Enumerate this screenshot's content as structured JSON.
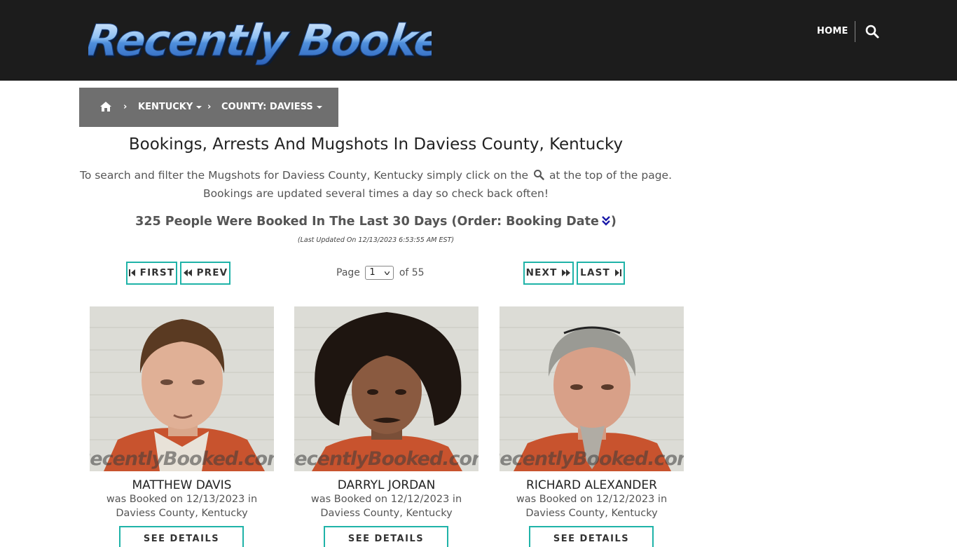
{
  "header": {
    "logo_text": "Recently Booked",
    "nav_home": "HOME",
    "search_icon": "search-icon"
  },
  "breadcrumb": {
    "home_icon": "home-icon",
    "state": "KENTUCKY",
    "county": "COUNTY: DAVIESS"
  },
  "main": {
    "title": "Bookings, Arrests And Mugshots In Daviess County, Kentucky",
    "intro_part1": "To search and filter the Mugshots for Daviess County, Kentucky simply click on the",
    "intro_part2": "at the top of the page.",
    "intro_line2": "Bookings are updated several times a day so check back often!",
    "count_text": "325 People Were Booked In The Last 30 Days (Order: Booking Date",
    "count_close": ")",
    "updated": "(Last Updated On 12/13/2023 6:53:55 AM EST)"
  },
  "pagination": {
    "first": "FIRST",
    "prev": "PREV",
    "next": "NEXT",
    "last": "LAST",
    "page_prefix": "Page",
    "page_value": "1",
    "page_suffix": "of 55"
  },
  "colors": {
    "accent": "#1fb3a8",
    "header_bg": "#1c1c1c",
    "breadcrumb_bg": "#6f6f6f"
  },
  "watermark": "RecentlyBooked.com",
  "cards": [
    {
      "name": "MATTHEW DAVIS",
      "booked_line1": "was Booked on 12/13/2023 in",
      "booked_line2": "Daviess County, Kentucky",
      "button": "SEE DETAILS"
    },
    {
      "name": "DARRYL JORDAN",
      "booked_line1": "was Booked on 12/12/2023 in",
      "booked_line2": "Daviess County, Kentucky",
      "button": "SEE DETAILS"
    },
    {
      "name": "RICHARD ALEXANDER",
      "booked_line1": "was Booked on 12/12/2023 in",
      "booked_line2": "Daviess County, Kentucky",
      "button": "SEE DETAILS"
    }
  ]
}
